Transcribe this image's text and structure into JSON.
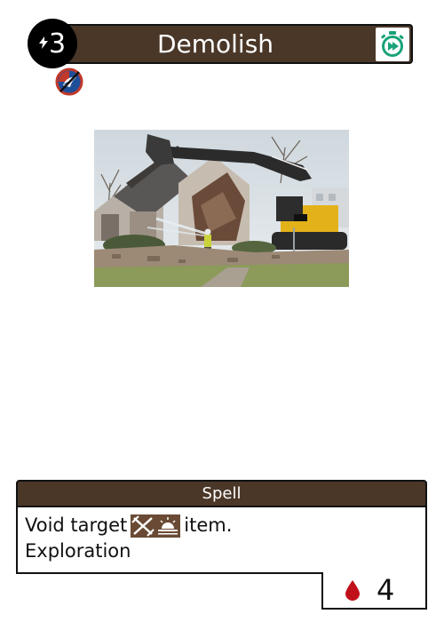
{
  "card": {
    "name": "Demolish",
    "cost": "3",
    "type": "Spell",
    "rules_text_before": "Void target",
    "rules_text_after": "item.",
    "keyword": "Exploration",
    "stat_value": "4"
  },
  "icons": {
    "cost": "lightning-bolt-icon",
    "timer": "stopwatch-fast-forward-icon",
    "restriction": "no-flying-icon",
    "target_tags": [
      "crossed-tools-icon",
      "sunrise-icon"
    ],
    "stat": "blood-drop-icon"
  },
  "colors": {
    "bar": "#4a3728",
    "timer": "#1aa37a",
    "restriction_red": "#c0392b",
    "restriction_blue": "#1f4e99",
    "blood": "#c0101a"
  }
}
